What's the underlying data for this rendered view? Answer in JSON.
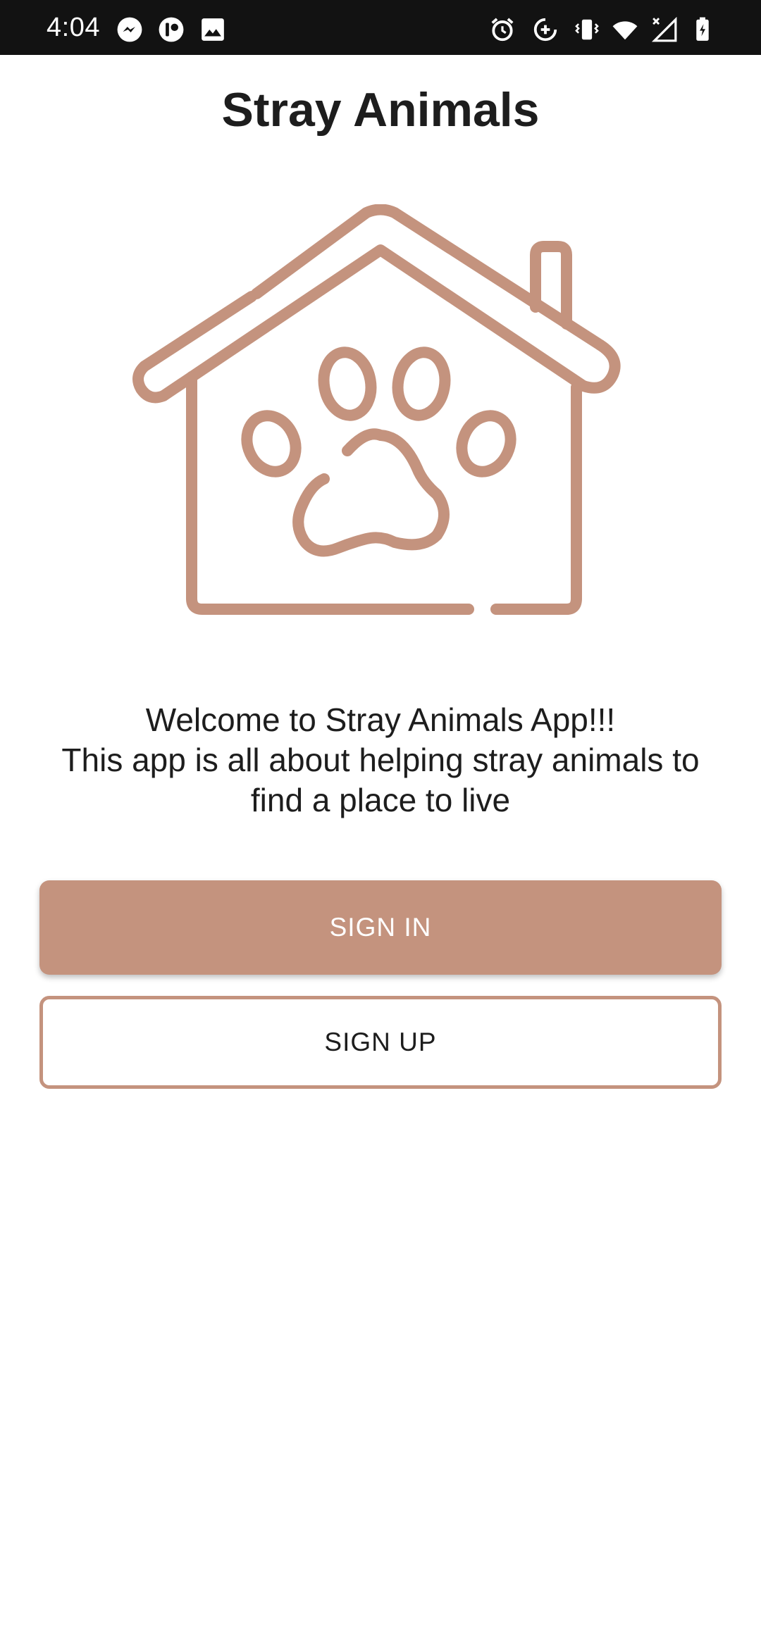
{
  "status_bar": {
    "time": "4:04",
    "left_icons": [
      "messenger-icon",
      "app-notification-icon",
      "image-icon"
    ],
    "right_icons": [
      "alarm-icon",
      "data-saver-icon",
      "vibrate-icon",
      "wifi-icon",
      "signal-icon",
      "battery-charging-icon"
    ]
  },
  "app": {
    "title": "Stray Animals"
  },
  "hero": {
    "icon": "house-paw-icon",
    "color": "#c4937e"
  },
  "welcome": {
    "line1": "Welcome to Stray Animals App!!!",
    "line2": "This app is all about helping stray animals to",
    "line3": "find a place to live"
  },
  "buttons": {
    "sign_in": "SIGN IN",
    "sign_up": "SIGN UP"
  },
  "colors": {
    "accent": "#c4937e",
    "status_bar_bg": "#121212",
    "text": "#1d1d1d"
  }
}
